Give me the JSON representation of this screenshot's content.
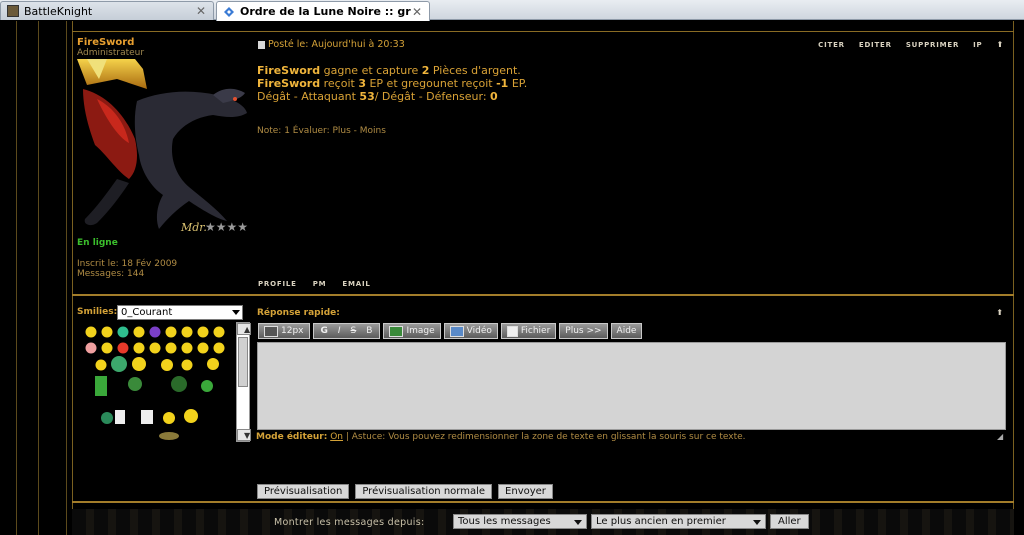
{
  "browser": {
    "tabs": [
      {
        "title": "BattleKnight",
        "active": false,
        "icon": "battleknight-favicon"
      },
      {
        "title": "Ordre de la Lune Noire :: gregoun...",
        "active": true,
        "icon": "forum-favicon"
      }
    ],
    "close_glyph": "✕"
  },
  "post": {
    "author": "FireSword",
    "rank": "Administrateur",
    "status": "En ligne",
    "joined": "Inscrit le: 18 Fév 2009",
    "messages": "Messages: 144",
    "posted": "Posté le: Aujourd'hui à 20:33",
    "actions": {
      "quote": "CITER",
      "edit": "EDITER",
      "delete": "SUPPRIMER",
      "ip": "IP",
      "up": "⬆"
    },
    "lines": {
      "l1": {
        "p1": "FireSword",
        "p2": " gagne et capture ",
        "p3": "2",
        "p4": " Pièces d'argent."
      },
      "l2": {
        "p1": "FireSword",
        "p2": " reçoit ",
        "p3": "3",
        "p4": " EP et gregounet reçoit ",
        "p5": "-1",
        "p6": " EP."
      },
      "l3": {
        "p1": "Dégât - Attaquant ",
        "p2": "53",
        "p3": "/ Dégât - Défenseur: ",
        "p4": "0"
      }
    },
    "vote": "Note: 1  Évaluer: Plus - Moins",
    "profile_links": {
      "profile": "PROFILE",
      "pm": "PM",
      "email": "EMAIL"
    },
    "signature": "Mdr.",
    "stars": "★★★★"
  },
  "quick_reply": {
    "smilies_label": "Smilies:",
    "smilies_category": "0_Courant",
    "title": "Réponse rapide:",
    "up": "⬆",
    "toolbar": {
      "size": "12px",
      "bold": "G",
      "italic": "I",
      "strike": "S",
      "b": "B",
      "image": "Image",
      "video": "Vidéo",
      "files": "Fichier",
      "more": "Plus >>",
      "help": "Aide"
    },
    "editor_mode_label": "Mode éditeur:",
    "editor_mode_value": "On",
    "tip": " | Astuce: Vous pouvez redimensionner la zone de texte en glissant la souris sur ce texte.",
    "buttons": {
      "preview": "Prévisualisation",
      "normal_preview": "Prévisualisation normale",
      "send": "Envoyer"
    }
  },
  "footer": {
    "show_label": "Montrer les messages depuis:",
    "period": "Tous les messages",
    "order": "Le plus ancien en premier",
    "go": "Aller"
  },
  "colors": {
    "accent": "#d4a238",
    "online": "#3bbf2c",
    "background": "#000000"
  }
}
